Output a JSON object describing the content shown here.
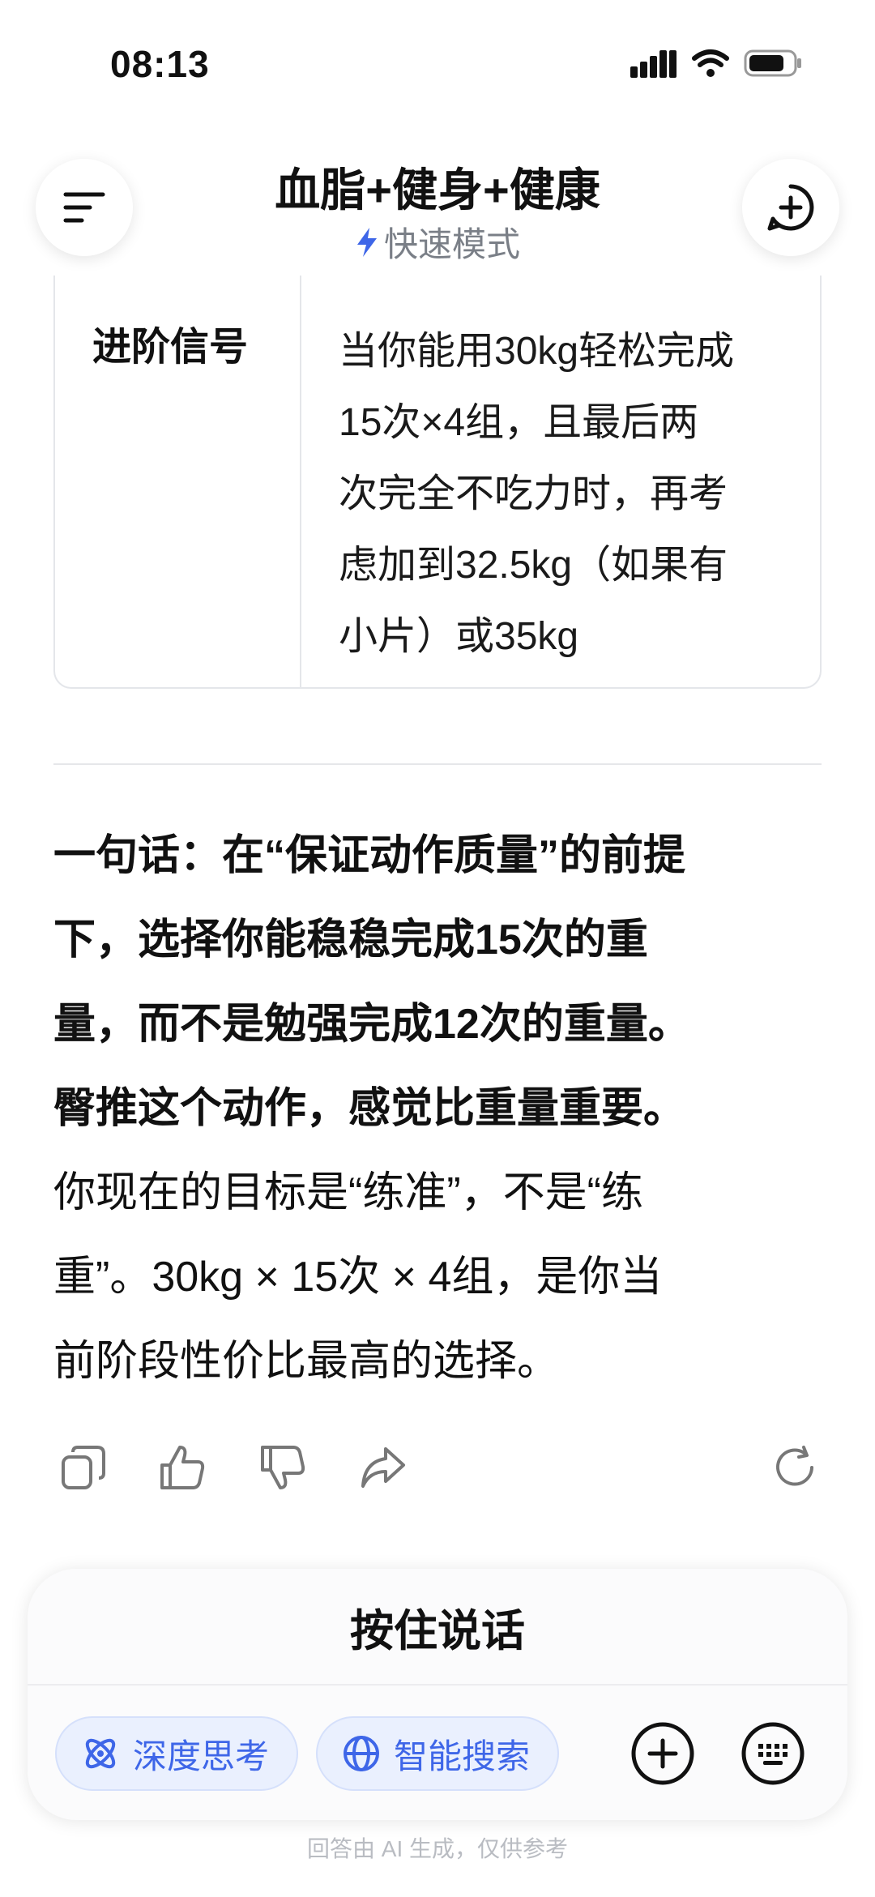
{
  "status_bar": {
    "time": "08:13"
  },
  "header": {
    "title": "血脂+健身+健康",
    "mode_label": "快速模式"
  },
  "table": {
    "header": "进阶信号",
    "cell_lines": [
      "当你能用30kg轻松完成",
      "15次×4组，且最后两",
      "次完全不吃力时，再考",
      "虑加到32.5kg（如果有",
      "小片）或35kg"
    ]
  },
  "answer": {
    "bold_lines": [
      "一句话：在“保证动作质量”的前提",
      "下，选择你能稳稳完成15次的重",
      "量，而不是勉强完成12次的重量。",
      "臀推这个动作，感觉比重量重要。"
    ],
    "normal_lines": [
      "你现在的目标是“练准”，不是“练",
      "重”。30kg × 15次 × 4组，是你当",
      "前阶段性价比最高的选择。"
    ]
  },
  "actions": [
    "copy-icon",
    "thumbs-up-icon",
    "thumbs-down-icon",
    "share-icon",
    "regenerate-icon"
  ],
  "input_panel": {
    "hold_to_talk": "按住说话",
    "chip_deep_think": "深度思考",
    "chip_smart_search": "智能搜索"
  },
  "footer_note": "回答由 AI 生成，仅供参考",
  "colors": {
    "accent": "#3e66e8",
    "chip_bg": "#eaf0fe",
    "muted": "#7a7f87"
  }
}
